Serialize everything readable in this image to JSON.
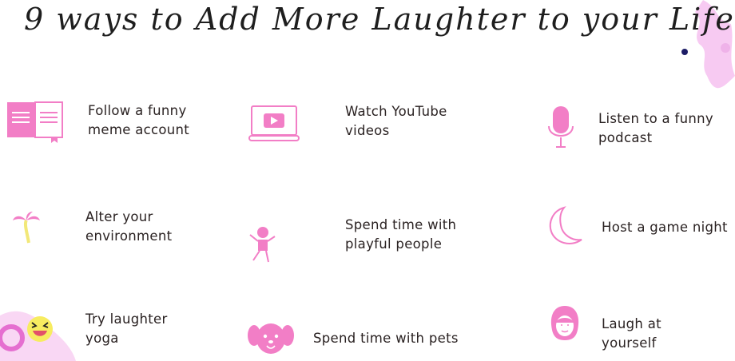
{
  "title": "9 ways to Add More Laughter to your Life",
  "accent_color": "#f27ec6",
  "tips": [
    {
      "label": "Follow a funny\nmeme account",
      "icon": "book-icon"
    },
    {
      "label": "Watch YouTube\nvideos",
      "icon": "laptop-play-icon"
    },
    {
      "label": "Listen to a funny\npodcast",
      "icon": "microphone-icon"
    },
    {
      "label": "Alter your\nenvironment",
      "icon": "palm-tree-icon"
    },
    {
      "label": "Spend time with\nplayful people",
      "icon": "jumping-person-icon"
    },
    {
      "label": "Host a game night",
      "icon": "moon-icon"
    },
    {
      "label": "Try laughter\nyoga",
      "icon": "laughing-emoji-icon"
    },
    {
      "label": "Spend time with pets",
      "icon": "dog-icon"
    },
    {
      "label": "Laugh at\nyourself",
      "icon": "girl-face-icon"
    }
  ]
}
